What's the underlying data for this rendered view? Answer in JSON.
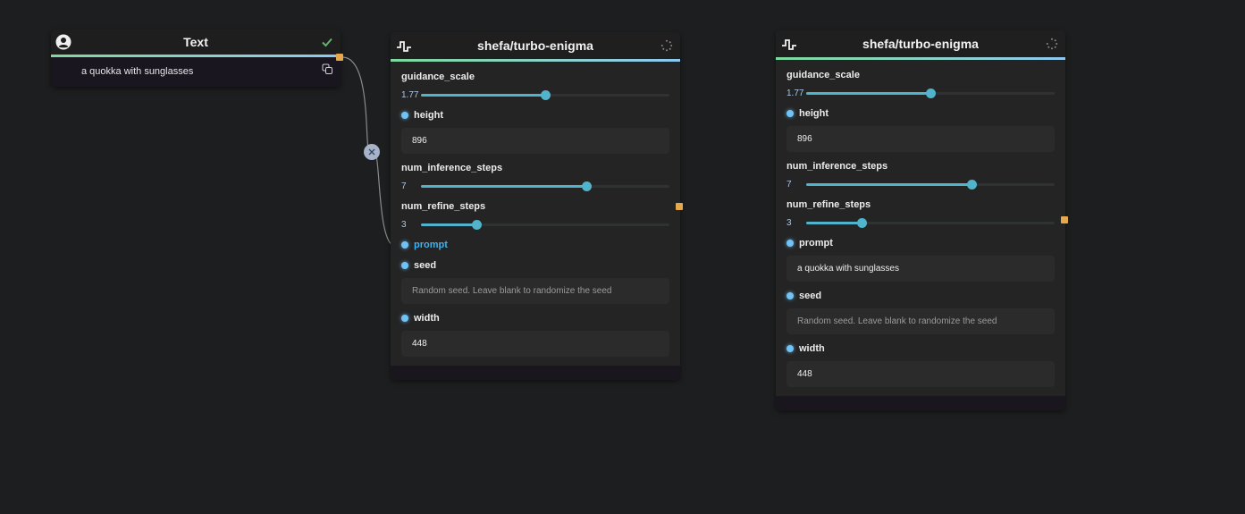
{
  "canvas": {
    "background": "#1c1e1f",
    "edges": [
      {
        "from": "text-node.output",
        "to": "model-node-1.prompt",
        "delete_button_icon": "close-icon"
      }
    ]
  },
  "text_node": {
    "title": "Text",
    "header_icon": "user-circle-icon",
    "status_icon": "check-icon",
    "status_color": "#5fb56f",
    "value": "a quokka with sunglasses",
    "copy_icon": "copy-icon"
  },
  "model_nodes": [
    {
      "title": "shefa/turbo-enigma",
      "header_icon": "waveform-icon",
      "status_icon": "loading-spinner-icon",
      "fields": {
        "guidance_scale": {
          "label": "guidance_scale",
          "value": "1.77",
          "fraction": 0.5
        },
        "height": {
          "label": "height",
          "value": "896"
        },
        "num_inference_steps": {
          "label": "num_inference_steps",
          "value": "7",
          "fraction": 0.667
        },
        "num_refine_steps": {
          "label": "num_refine_steps",
          "value": "3",
          "fraction": 0.222
        },
        "prompt": {
          "label": "prompt",
          "connected": true
        },
        "seed": {
          "label": "seed",
          "placeholder": "Random seed. Leave blank to randomize the seed"
        },
        "width": {
          "label": "width",
          "value": "448"
        }
      }
    },
    {
      "title": "shefa/turbo-enigma",
      "header_icon": "waveform-icon",
      "status_icon": "loading-spinner-icon",
      "fields": {
        "guidance_scale": {
          "label": "guidance_scale",
          "value": "1.77",
          "fraction": 0.5
        },
        "height": {
          "label": "height",
          "value": "896"
        },
        "num_inference_steps": {
          "label": "num_inference_steps",
          "value": "7",
          "fraction": 0.667
        },
        "num_refine_steps": {
          "label": "num_refine_steps",
          "value": "3",
          "fraction": 0.222
        },
        "prompt": {
          "label": "prompt",
          "value": "a quokka with sunglasses"
        },
        "seed": {
          "label": "seed",
          "placeholder": "Random seed. Leave blank to randomize the seed"
        },
        "width": {
          "label": "width",
          "value": "448"
        }
      }
    }
  ]
}
